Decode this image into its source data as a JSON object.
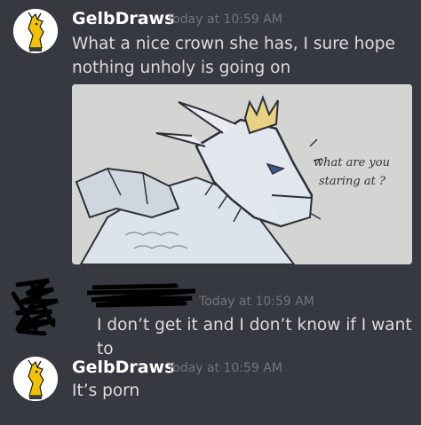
{
  "messages": [
    {
      "username": "GelbDraws",
      "timestamp": "Today at 10:59 AM",
      "lines": [
        "What a nice crown she has, I sure hope",
        "nothing unholy is going on"
      ],
      "image_caption": [
        "what are you",
        "staring at ?"
      ]
    },
    {
      "username": "",
      "timestamp": "Today at 10:59 AM",
      "lines": [
        "I don’t get it and I don’t know if I want to"
      ]
    },
    {
      "username": "GelbDraws",
      "timestamp": "Today at 10:59 AM",
      "lines": [
        "It’s porn"
      ]
    }
  ],
  "colors": {
    "background": "#36393f",
    "username": "#ffffff",
    "timestamp": "#72767d",
    "message_text": "#dcddde",
    "avatar_accent": "#f2c200"
  }
}
